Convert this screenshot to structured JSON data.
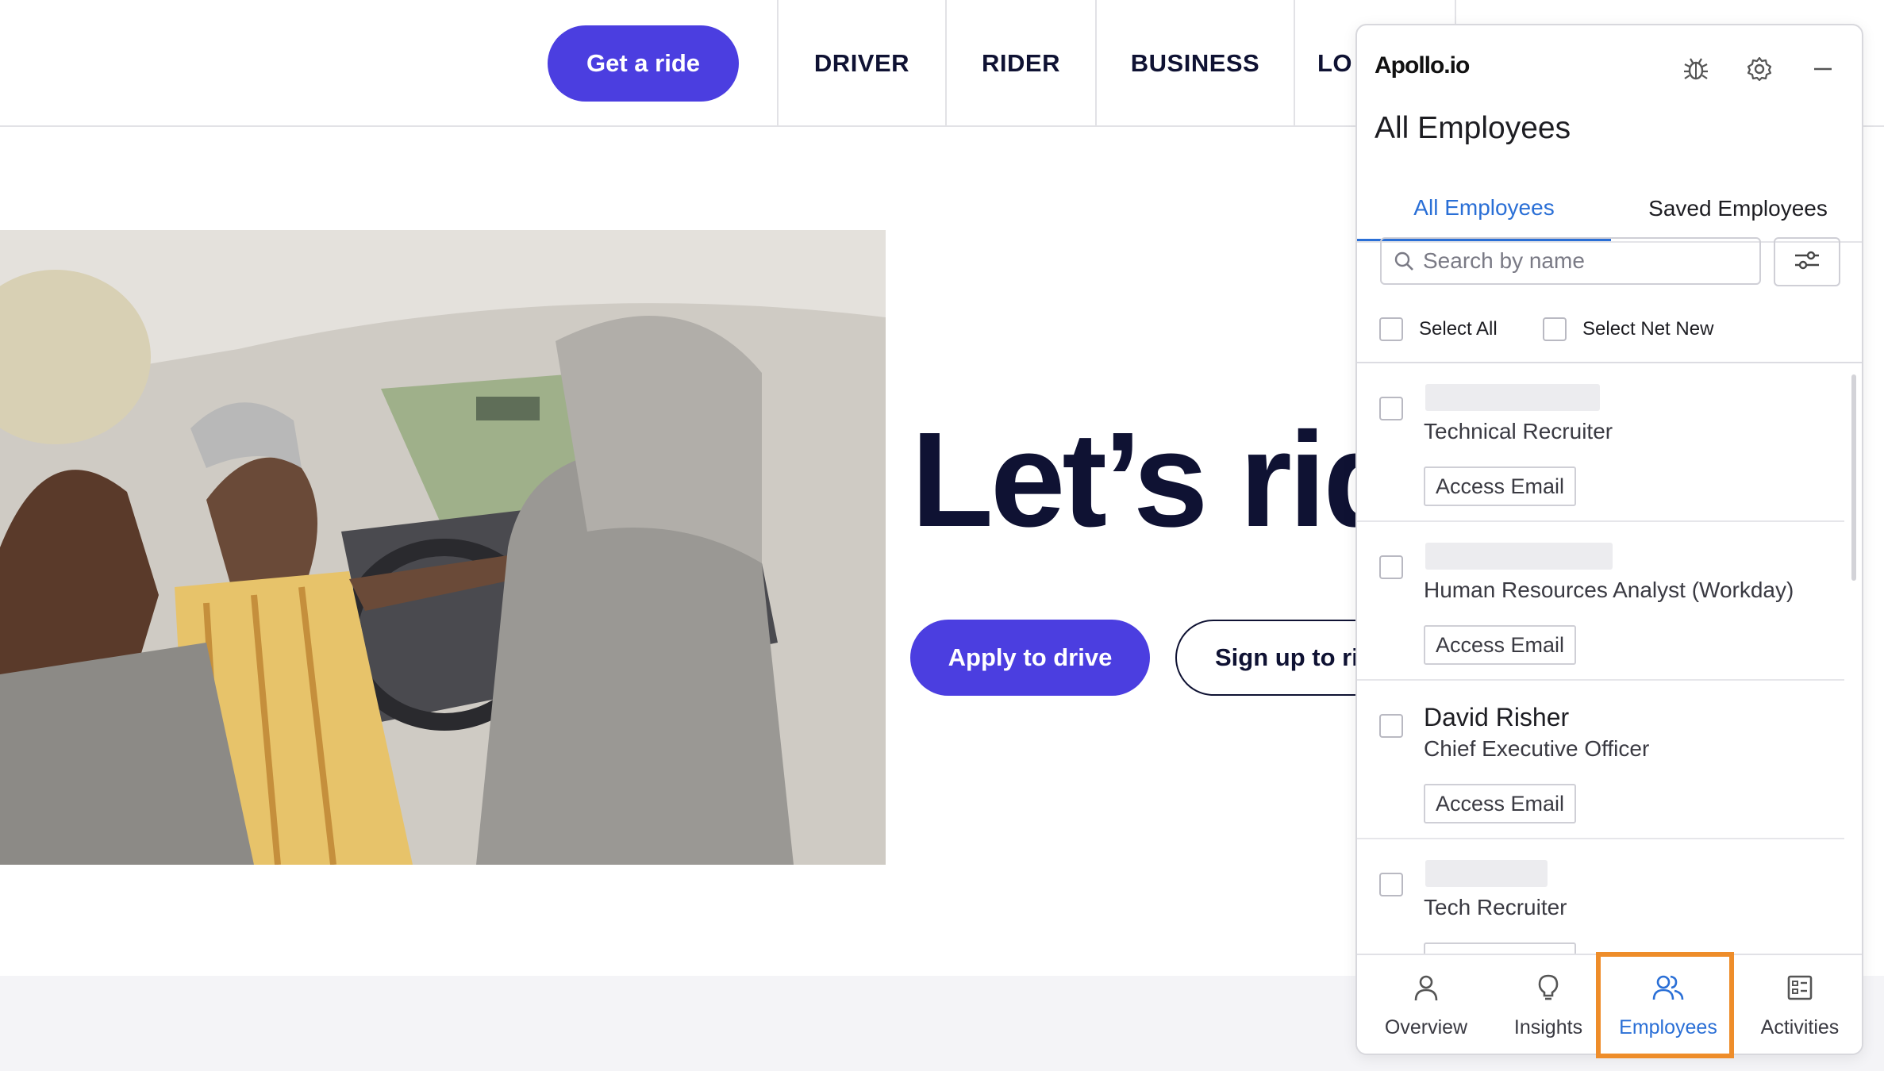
{
  "site": {
    "get_ride_label": "Get a ride",
    "nav": [
      "DRIVER",
      "RIDER",
      "BUSINESS",
      "LO"
    ],
    "hero_title": "Let’s ride",
    "apply_label": "Apply to drive",
    "signup_label": "Sign up to ride",
    "accent_color": "#4b3ee0"
  },
  "apollo": {
    "logo_text": "Apollo.io",
    "header_icons": [
      "bug-icon",
      "gear-icon",
      "minimize-icon"
    ],
    "title": "All Employees",
    "tabs": [
      {
        "label": "All Employees",
        "active": true
      },
      {
        "label": "Saved Employees",
        "active": false
      }
    ],
    "search": {
      "placeholder": "Search by name"
    },
    "select_all_label": "Select All",
    "select_net_new_label": "Select Net New",
    "employees": [
      {
        "name": "",
        "role": "Technical Recruiter",
        "action": "Access Email"
      },
      {
        "name": "",
        "role": "Human Resources Analyst (Workday)",
        "action": "Access Email"
      },
      {
        "name": "David Risher",
        "role": "Chief Executive Officer",
        "action": "Access Email"
      },
      {
        "name": "",
        "role": "Tech Recruiter",
        "action": "Access Email"
      }
    ],
    "bottom_nav": [
      {
        "label": "Overview",
        "icon": "person-icon",
        "active": false
      },
      {
        "label": "Insights",
        "icon": "lightbulb-icon",
        "active": false
      },
      {
        "label": "Employees",
        "icon": "people-icon",
        "active": true
      },
      {
        "label": "Activities",
        "icon": "list-icon",
        "active": false
      }
    ],
    "active_color": "#2a6fd6",
    "highlight_color": "#ee8d2a"
  }
}
